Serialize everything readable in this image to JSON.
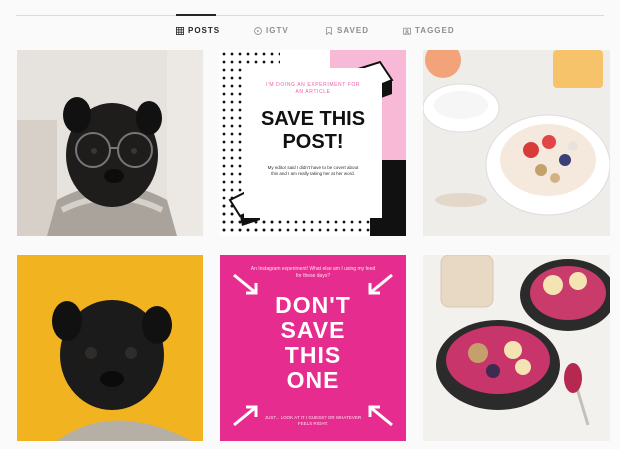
{
  "tabs": [
    {
      "label": "POSTS",
      "icon": "grid-icon",
      "active": true
    },
    {
      "label": "IGTV",
      "icon": "igtv-icon",
      "active": false
    },
    {
      "label": "SAVED",
      "icon": "bookmark-icon",
      "active": false
    },
    {
      "label": "TAGGED",
      "icon": "tag-icon",
      "active": false
    }
  ],
  "posts": {
    "save_post": {
      "top_text": "I'M DOING AN EXPERIMENT FOR AN ARTICLE",
      "headline_line1": "SAVE THIS",
      "headline_line2": "POST!",
      "body_text": "My editor said I didn't have to be covert about this and I am really taking her at her word."
    },
    "dont_save": {
      "top_text": "An Instagram experiment! What else am I using my feed for these days?",
      "line1": "DON'T",
      "line2": "SAVE",
      "line3": "THIS",
      "line4": "ONE",
      "bottom_text": "JUST... LOOK AT IT I GUESS? OR WHATEVER FEELS RIGHT."
    }
  },
  "colors": {
    "accent_pink": "#e62c8f",
    "yellow": "#f2b320",
    "light_pink": "#f7b9d5"
  }
}
